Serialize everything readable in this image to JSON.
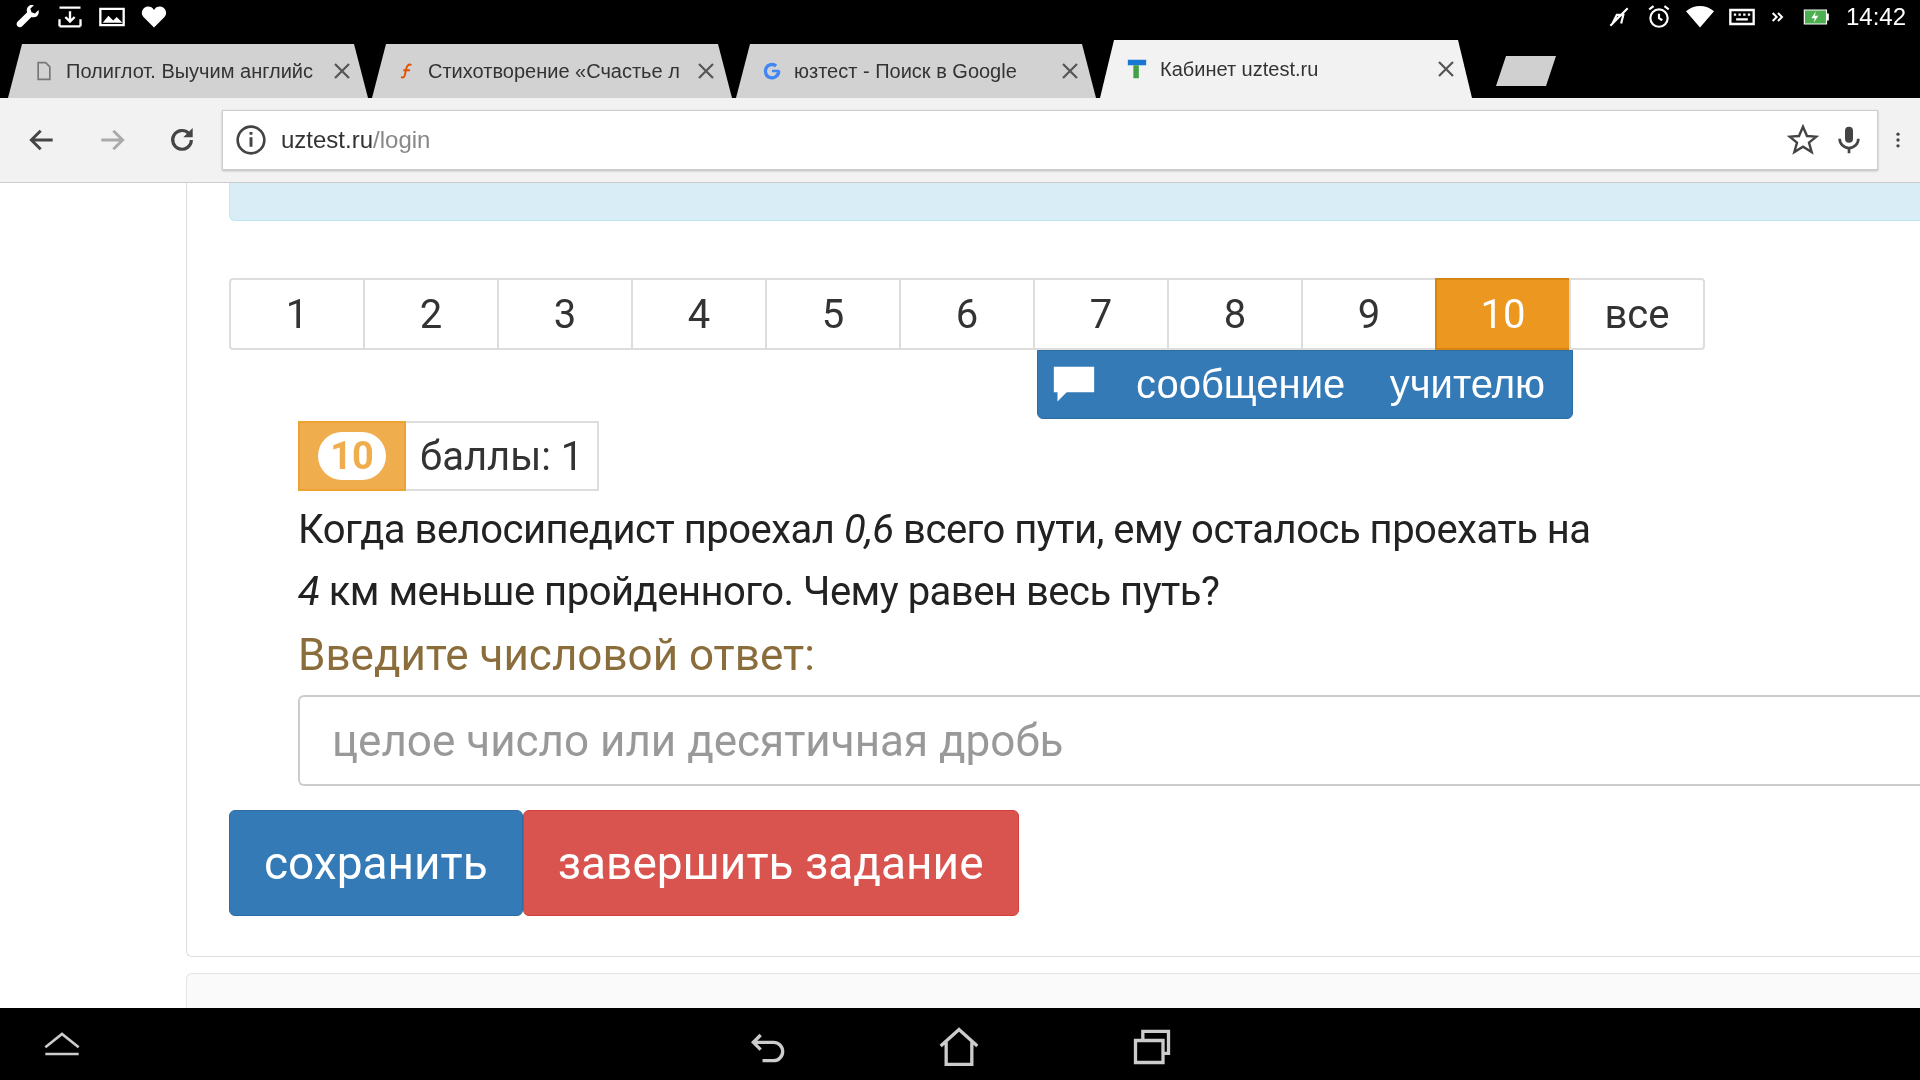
{
  "status_bar": {
    "time": "14:42"
  },
  "tabs": [
    {
      "title": "Полиглот. Выучим английс",
      "selected": false
    },
    {
      "title": "Стихотворение «Счастье л",
      "selected": false
    },
    {
      "title": "юзтест - Поиск в Google",
      "selected": false
    },
    {
      "title": "Кабинет uztest.ru",
      "selected": true
    }
  ],
  "address": {
    "host": "uztest.ru",
    "path": "/login"
  },
  "pagination": [
    {
      "label": "1",
      "selected": false
    },
    {
      "label": "2",
      "selected": false
    },
    {
      "label": "3",
      "selected": false
    },
    {
      "label": "4",
      "selected": false
    },
    {
      "label": "5",
      "selected": false
    },
    {
      "label": "6",
      "selected": false
    },
    {
      "label": "7",
      "selected": false
    },
    {
      "label": "8",
      "selected": false
    },
    {
      "label": "9",
      "selected": false
    },
    {
      "label": "10",
      "selected": true
    },
    {
      "label": "все",
      "selected": false
    }
  ],
  "message_button": {
    "label": "сообщение    учителю"
  },
  "question": {
    "number": "10",
    "points": "баллы: 1",
    "text": "Когда велосипедист проехал *0,6* всего пути, ему осталось проехать на *4* км меньше пройденного. Чему равен весь путь?"
  },
  "answer": {
    "label": "Введите числовой ответ:",
    "placeholder": "целое число или десятичная дробь"
  },
  "buttons": [
    {
      "label": "сохранить",
      "kind": "primary"
    },
    {
      "label": "завершить задание",
      "kind": "danger"
    }
  ]
}
